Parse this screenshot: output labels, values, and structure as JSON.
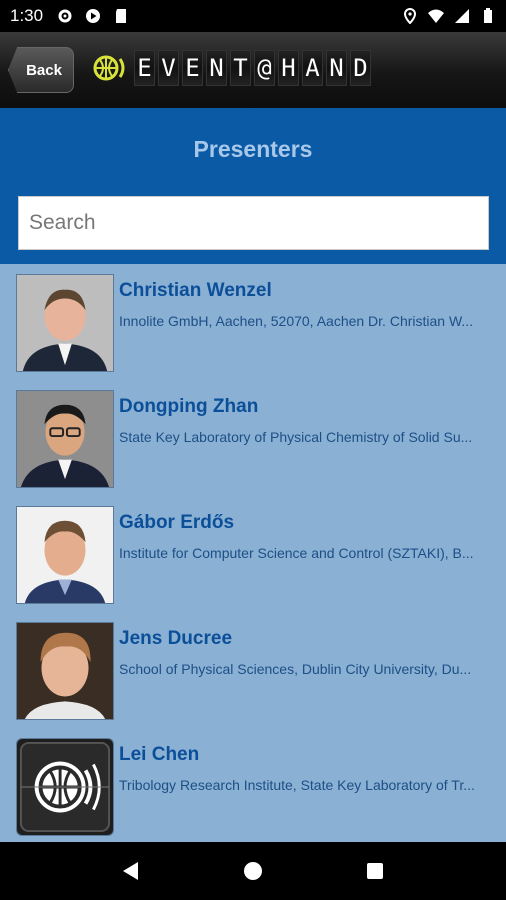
{
  "status_bar": {
    "time": "1:30",
    "left_icons": [
      "gear-icon",
      "play-icon",
      "sd-card-icon"
    ],
    "right_icons": [
      "location-icon",
      "wifi-icon",
      "signal-icon",
      "battery-icon"
    ]
  },
  "header": {
    "back_label": "Back",
    "brand_letters": [
      "E",
      "V",
      "E",
      "N",
      "T",
      "@",
      "H",
      "A",
      "N",
      "D"
    ],
    "logo_color": "#d8e23a"
  },
  "page": {
    "title": "Presenters",
    "search_placeholder": "Search"
  },
  "presenters": [
    {
      "name": "Christian Wenzel",
      "org": "Innolite GmbH, Aachen, 52070, Aachen Dr. Christian W...",
      "photo": "portrait"
    },
    {
      "name": "Dongping Zhan",
      "org": "State Key Laboratory of Physical Chemistry of Solid Su...",
      "photo": "portrait"
    },
    {
      "name": "Gábor Erdős",
      "org": "Institute for Computer Science and Control (SZTAKI), B...",
      "photo": "portrait"
    },
    {
      "name": "Jens Ducree",
      "org": "School of Physical Sciences, Dublin City University, Du...",
      "photo": "portrait"
    },
    {
      "name": "Lei Chen",
      "org": "Tribology Research Institute, State Key Laboratory of Tr...",
      "photo": "event-logo-placeholder"
    }
  ],
  "nav": {
    "icons": [
      "back-triangle-icon",
      "home-circle-icon",
      "recents-square-icon"
    ]
  },
  "colors": {
    "title_band": "#0b5aa6",
    "list_background": "#8ab0d4",
    "name_text": "#0c4f99"
  }
}
